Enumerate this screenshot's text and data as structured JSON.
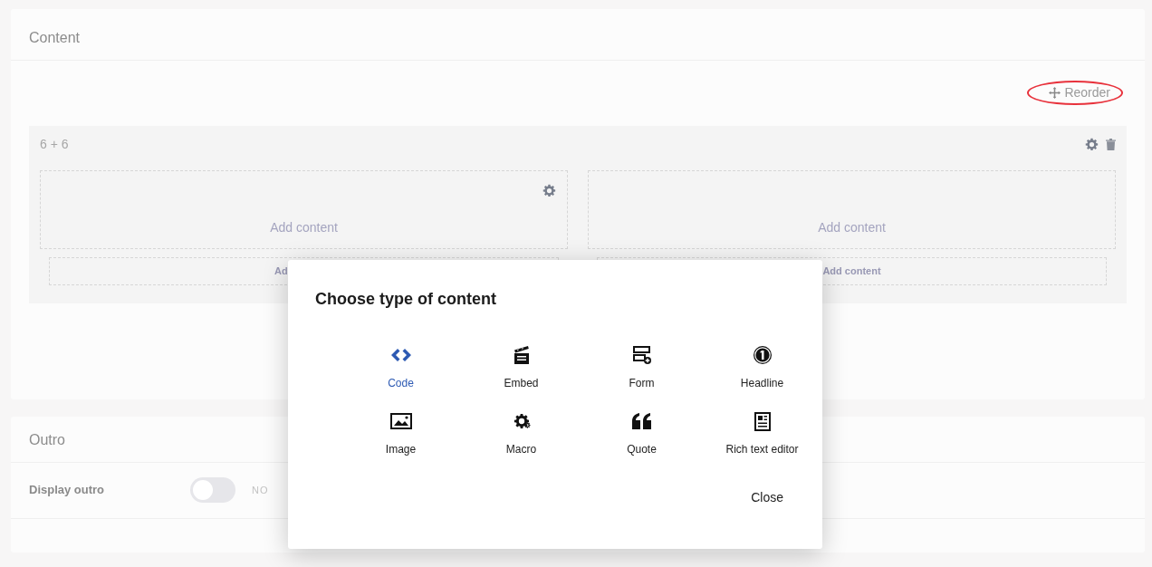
{
  "content_panel": {
    "title": "Content",
    "reorder_button": "Reorder",
    "grid": {
      "title": "6 + 6",
      "cells": [
        {
          "label": "Add content",
          "add_below": "Ad"
        },
        {
          "label": "Add content",
          "add_below": "Add content"
        }
      ]
    }
  },
  "outro_panel": {
    "title": "Outro",
    "fields": [
      {
        "label": "Display outro",
        "on": false,
        "state_label": "NO"
      }
    ]
  },
  "dialog": {
    "title": "Choose type of content",
    "items": [
      {
        "label": "Code",
        "selected": true
      },
      {
        "label": "Embed",
        "selected": false
      },
      {
        "label": "Form",
        "selected": false
      },
      {
        "label": "Headline",
        "selected": false
      },
      {
        "label": "Image",
        "selected": false
      },
      {
        "label": "Macro",
        "selected": false
      },
      {
        "label": "Quote",
        "selected": false
      },
      {
        "label": "Rich text editor",
        "selected": false
      }
    ],
    "close_button": "Close"
  }
}
